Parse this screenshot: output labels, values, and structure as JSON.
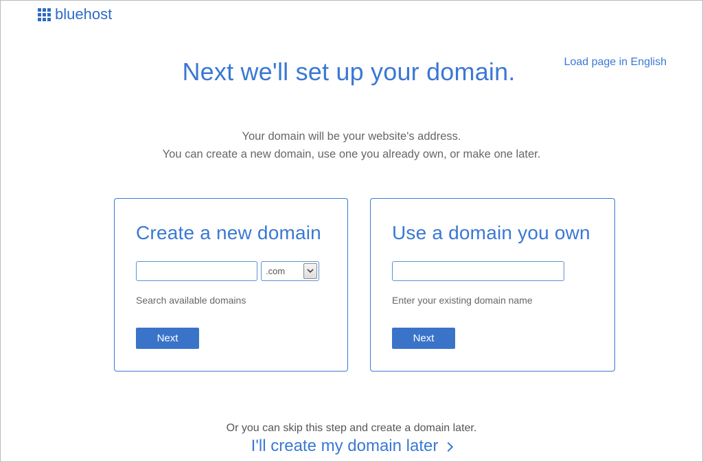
{
  "header": {
    "brand": "bluehost",
    "logo_icon": "grid-logo-icon",
    "lang_link": "Load page in English"
  },
  "main": {
    "title": "Next we'll set up your domain.",
    "intro_line1": "Your domain will be your website's address.",
    "intro_line2": "You can create a new domain, use one you already own, or make one later."
  },
  "new_domain": {
    "title": "Create a new domain",
    "input_value": "",
    "tld_selected": ".com",
    "helper": "Search available domains",
    "button": "Next"
  },
  "own_domain": {
    "title": "Use a domain you own",
    "input_value": "",
    "helper": "Enter your existing domain name",
    "button": "Next"
  },
  "footer": {
    "skip_text": "Or you can skip this step and create a domain later.",
    "later_link": "I'll create my domain later"
  },
  "colors": {
    "accent": "#3a78d4",
    "button": "#3a74c9",
    "text": "#555555"
  }
}
